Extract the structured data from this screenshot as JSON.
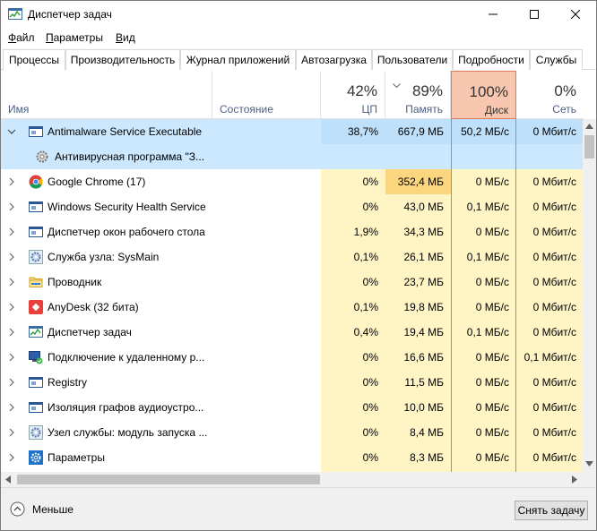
{
  "window": {
    "title": "Диспетчер задач"
  },
  "menu": {
    "items": [
      {
        "ul": "Ф",
        "rest": "айл"
      },
      {
        "ul": "П",
        "rest": "араметры"
      },
      {
        "ul": "В",
        "rest": "ид"
      }
    ]
  },
  "tabs": [
    "Процессы",
    "Производительность",
    "Журнал приложений",
    "Автозагрузка",
    "Пользователи",
    "Подробности",
    "Службы"
  ],
  "columns": {
    "name": "Имя",
    "status": "Состояние",
    "cpu": {
      "pct": "42%",
      "label": "ЦП"
    },
    "mem": {
      "pct": "89%",
      "label": "Память"
    },
    "disk": {
      "pct": "100%",
      "label": "Диск"
    },
    "net": {
      "pct": "0%",
      "label": "Сеть"
    }
  },
  "rows": [
    {
      "name": "Antimalware Service Executable",
      "cpu": "38,7%",
      "mem": "667,9 МБ",
      "disk": "50,2 МБ/с",
      "net": "0 Мбит/с",
      "icon": "window-icon",
      "expanded": true
    },
    {
      "name": "Антивирусная программа \"З...",
      "cpu": "",
      "mem": "",
      "disk": "",
      "net": "",
      "icon": "service-gear-icon",
      "child": true
    },
    {
      "name": "Google Chrome (17)",
      "cpu": "0%",
      "mem": "352,4 МБ",
      "disk": "0 МБ/с",
      "net": "0 Мбит/с",
      "icon": "chrome-icon"
    },
    {
      "name": "Windows Security Health Service",
      "cpu": "0%",
      "mem": "43,0 МБ",
      "disk": "0,1 МБ/с",
      "net": "0 Мбит/с",
      "icon": "window-icon"
    },
    {
      "name": "Диспетчер окон рабочего стола",
      "cpu": "1,9%",
      "mem": "34,3 МБ",
      "disk": "0 МБ/с",
      "net": "0 Мбит/с",
      "icon": "window-icon"
    },
    {
      "name": "Служба узла: SysMain",
      "cpu": "0,1%",
      "mem": "26,1 МБ",
      "disk": "0,1 МБ/с",
      "net": "0 Мбит/с",
      "icon": "gear-icon"
    },
    {
      "name": "Проводник",
      "cpu": "0%",
      "mem": "23,7 МБ",
      "disk": "0 МБ/с",
      "net": "0 Мбит/с",
      "icon": "folder-icon"
    },
    {
      "name": "AnyDesk (32 бита)",
      "cpu": "0,1%",
      "mem": "19,8 МБ",
      "disk": "0 МБ/с",
      "net": "0 Мбит/с",
      "icon": "anydesk-icon"
    },
    {
      "name": "Диспетчер задач",
      "cpu": "0,4%",
      "mem": "19,4 МБ",
      "disk": "0,1 МБ/с",
      "net": "0 Мбит/с",
      "icon": "taskmgr-icon"
    },
    {
      "name": "Подключение к удаленному р...",
      "cpu": "0%",
      "mem": "16,6 МБ",
      "disk": "0 МБ/с",
      "net": "0,1 Мбит/с",
      "icon": "remote-desktop-icon"
    },
    {
      "name": "Registry",
      "cpu": "0%",
      "mem": "11,5 МБ",
      "disk": "0 МБ/с",
      "net": "0 Мбит/с",
      "icon": "window-icon"
    },
    {
      "name": "Изоляция графов аудиоустро...",
      "cpu": "0%",
      "mem": "10,0 МБ",
      "disk": "0 МБ/с",
      "net": "0 Мбит/с",
      "icon": "window-icon"
    },
    {
      "name": "Узел службы: модуль запуска ...",
      "cpu": "0%",
      "mem": "8,4 МБ",
      "disk": "0 МБ/с",
      "net": "0 Мбит/с",
      "icon": "gear-icon"
    },
    {
      "name": "Параметры",
      "cpu": "0%",
      "mem": "8,3 МБ",
      "disk": "0 МБ/с",
      "net": "0 Мбит/с",
      "icon": "settings-gear-icon"
    }
  ],
  "footer": {
    "fewer": "Меньше",
    "end_task": "Снять задачу"
  },
  "colors": {
    "selected": "#cce8ff",
    "cpu_bg": "#fff4c4",
    "mem_hi": "#fcd67f",
    "disk_header": "#f9c7b0"
  }
}
